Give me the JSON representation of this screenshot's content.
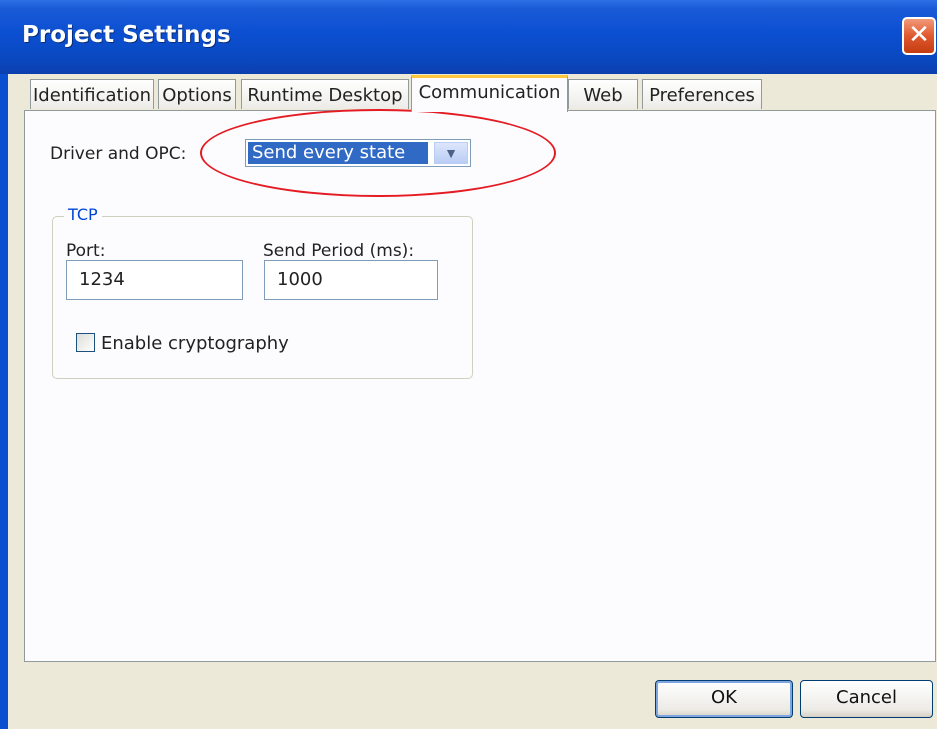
{
  "window": {
    "title": "Project Settings",
    "close_icon": "close-icon"
  },
  "tabs": [
    {
      "label": "Identification",
      "active": false
    },
    {
      "label": "Options",
      "active": false
    },
    {
      "label": "Runtime Desktop",
      "active": false
    },
    {
      "label": "Communication",
      "active": true
    },
    {
      "label": "Web",
      "active": false
    },
    {
      "label": "Preferences",
      "active": false
    }
  ],
  "communication": {
    "driver_label": "Driver and OPC:",
    "driver_value": "Send every state",
    "tcp_group": "TCP",
    "port_label": "Port:",
    "port_value": "1234",
    "send_period_label": "Send Period (ms):",
    "send_period_value": "1000",
    "crypto_label": "Enable cryptography",
    "crypto_checked": false
  },
  "buttons": {
    "ok": "OK",
    "cancel": "Cancel"
  },
  "colors": {
    "titlebar": "#0b4fd1",
    "highlight": "#316ac5",
    "annotation": "#e41b23",
    "group_title": "#0046d5"
  }
}
